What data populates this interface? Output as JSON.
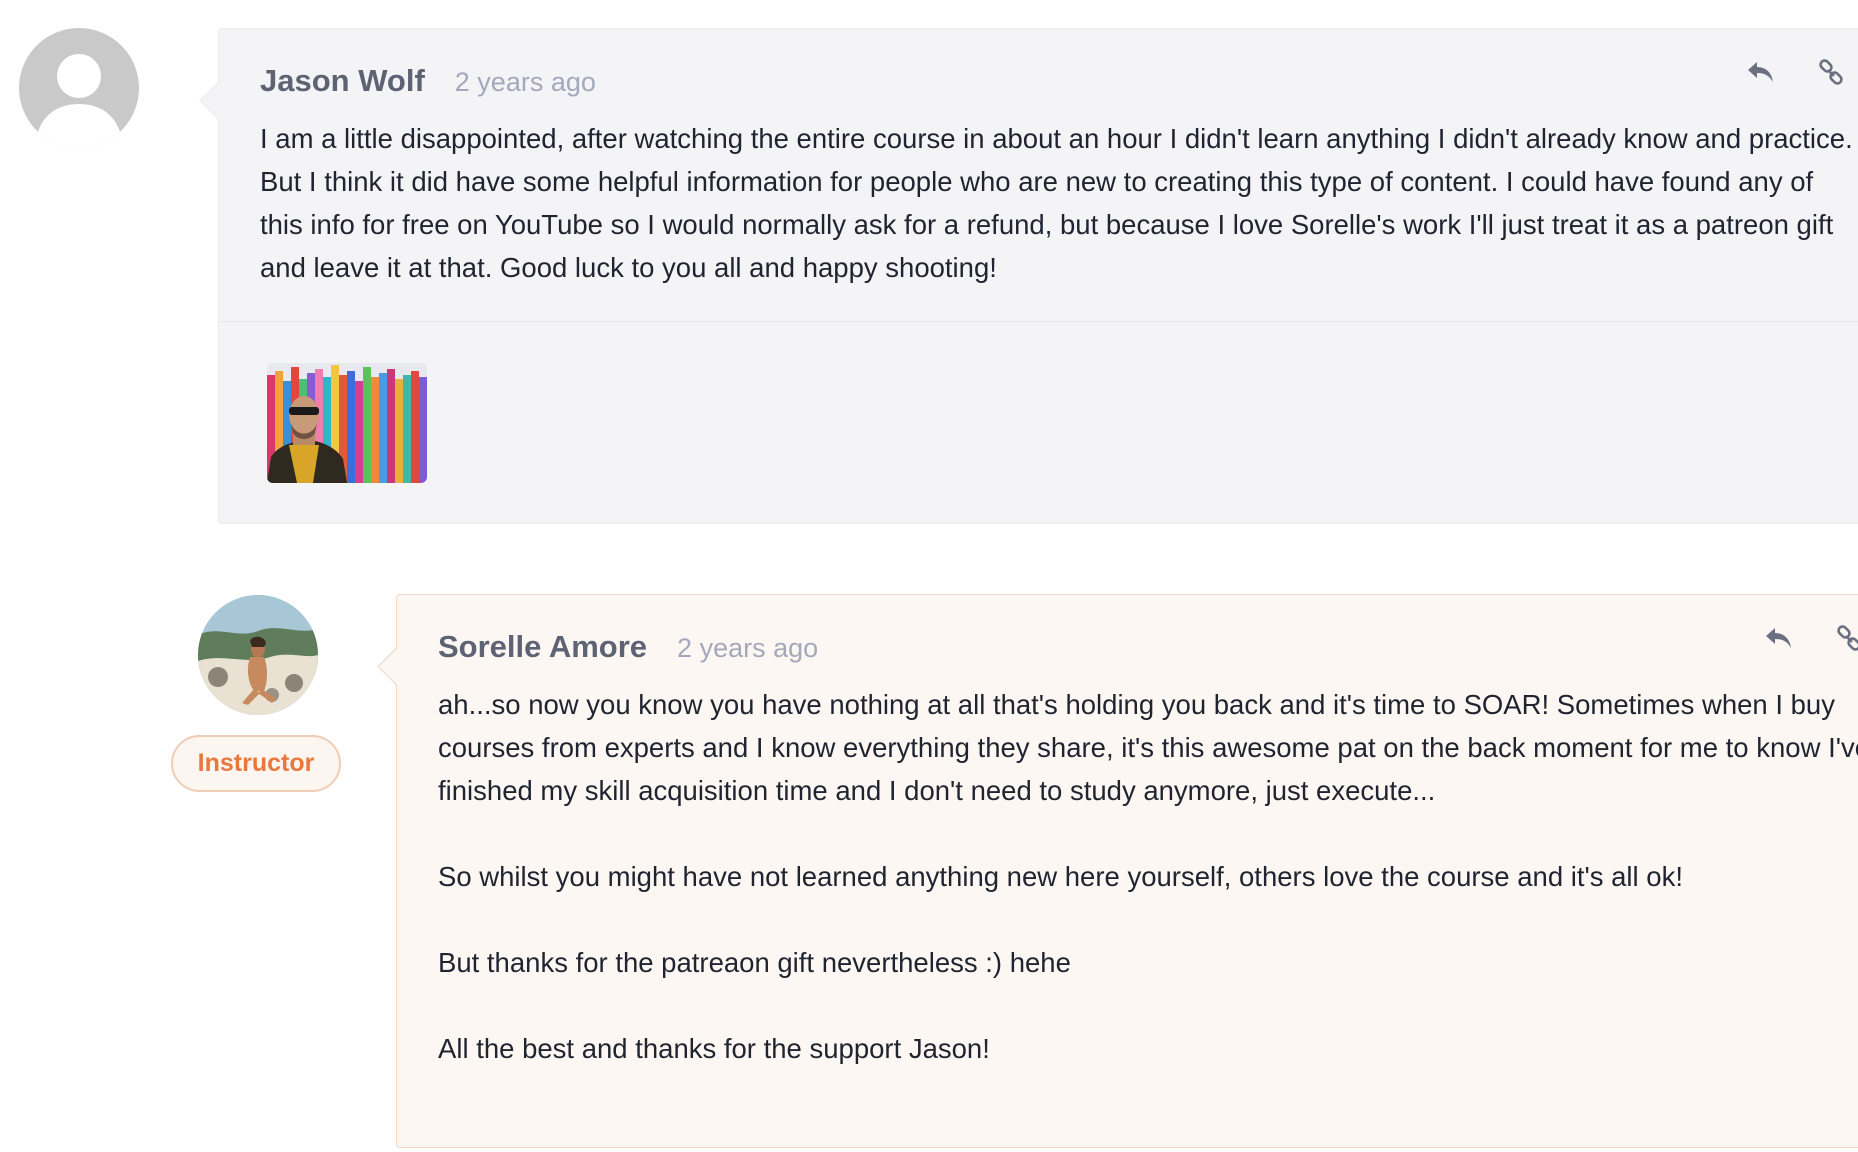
{
  "colors": {
    "accent_orange": "#e8793e",
    "author_text": "#5e6373",
    "timestamp_text": "#a3a8bb",
    "comment_bg": "#f4f4f6",
    "instructor_comment_bg": "#fcf7f2"
  },
  "comments": [
    {
      "author": "Jason Wolf",
      "time": "2 years ago",
      "avatar_icon": "default-user-icon",
      "paragraphs": [
        "I am a little disappointed, after watching the entire course in about an hour I didn't learn anything I didn't already know and practice. But I think it did have some helpful information for people who are new to creating this type of content. I could have found any of this info for free on YouTube so I would normally ask for a refund, but because I love Sorelle's work I'll just treat it as a patreon gift and leave it at that. Good luck to you all and happy shooting!"
      ],
      "actions": [
        "reply-icon",
        "link-icon"
      ],
      "has_attachment": true
    },
    {
      "author": "Sorelle Amore",
      "time": "2 years ago",
      "badge": "Instructor",
      "actions": [
        "reply-icon",
        "link-icon"
      ],
      "paragraphs": [
        "ah...so now you know you have nothing at all that's holding you back and it's time to SOAR! Sometimes when I buy courses from experts and I know everything they share, it's this awesome pat on the back moment for me to know I've finished my skill acquisition time and I don't need to study anymore, just execute...",
        "So whilst you might have not learned anything new here yourself, others love the course and it's all ok!",
        "But thanks for the patreaon gift nevertheless :) hehe",
        "All the best and thanks for the support Jason!"
      ]
    }
  ]
}
